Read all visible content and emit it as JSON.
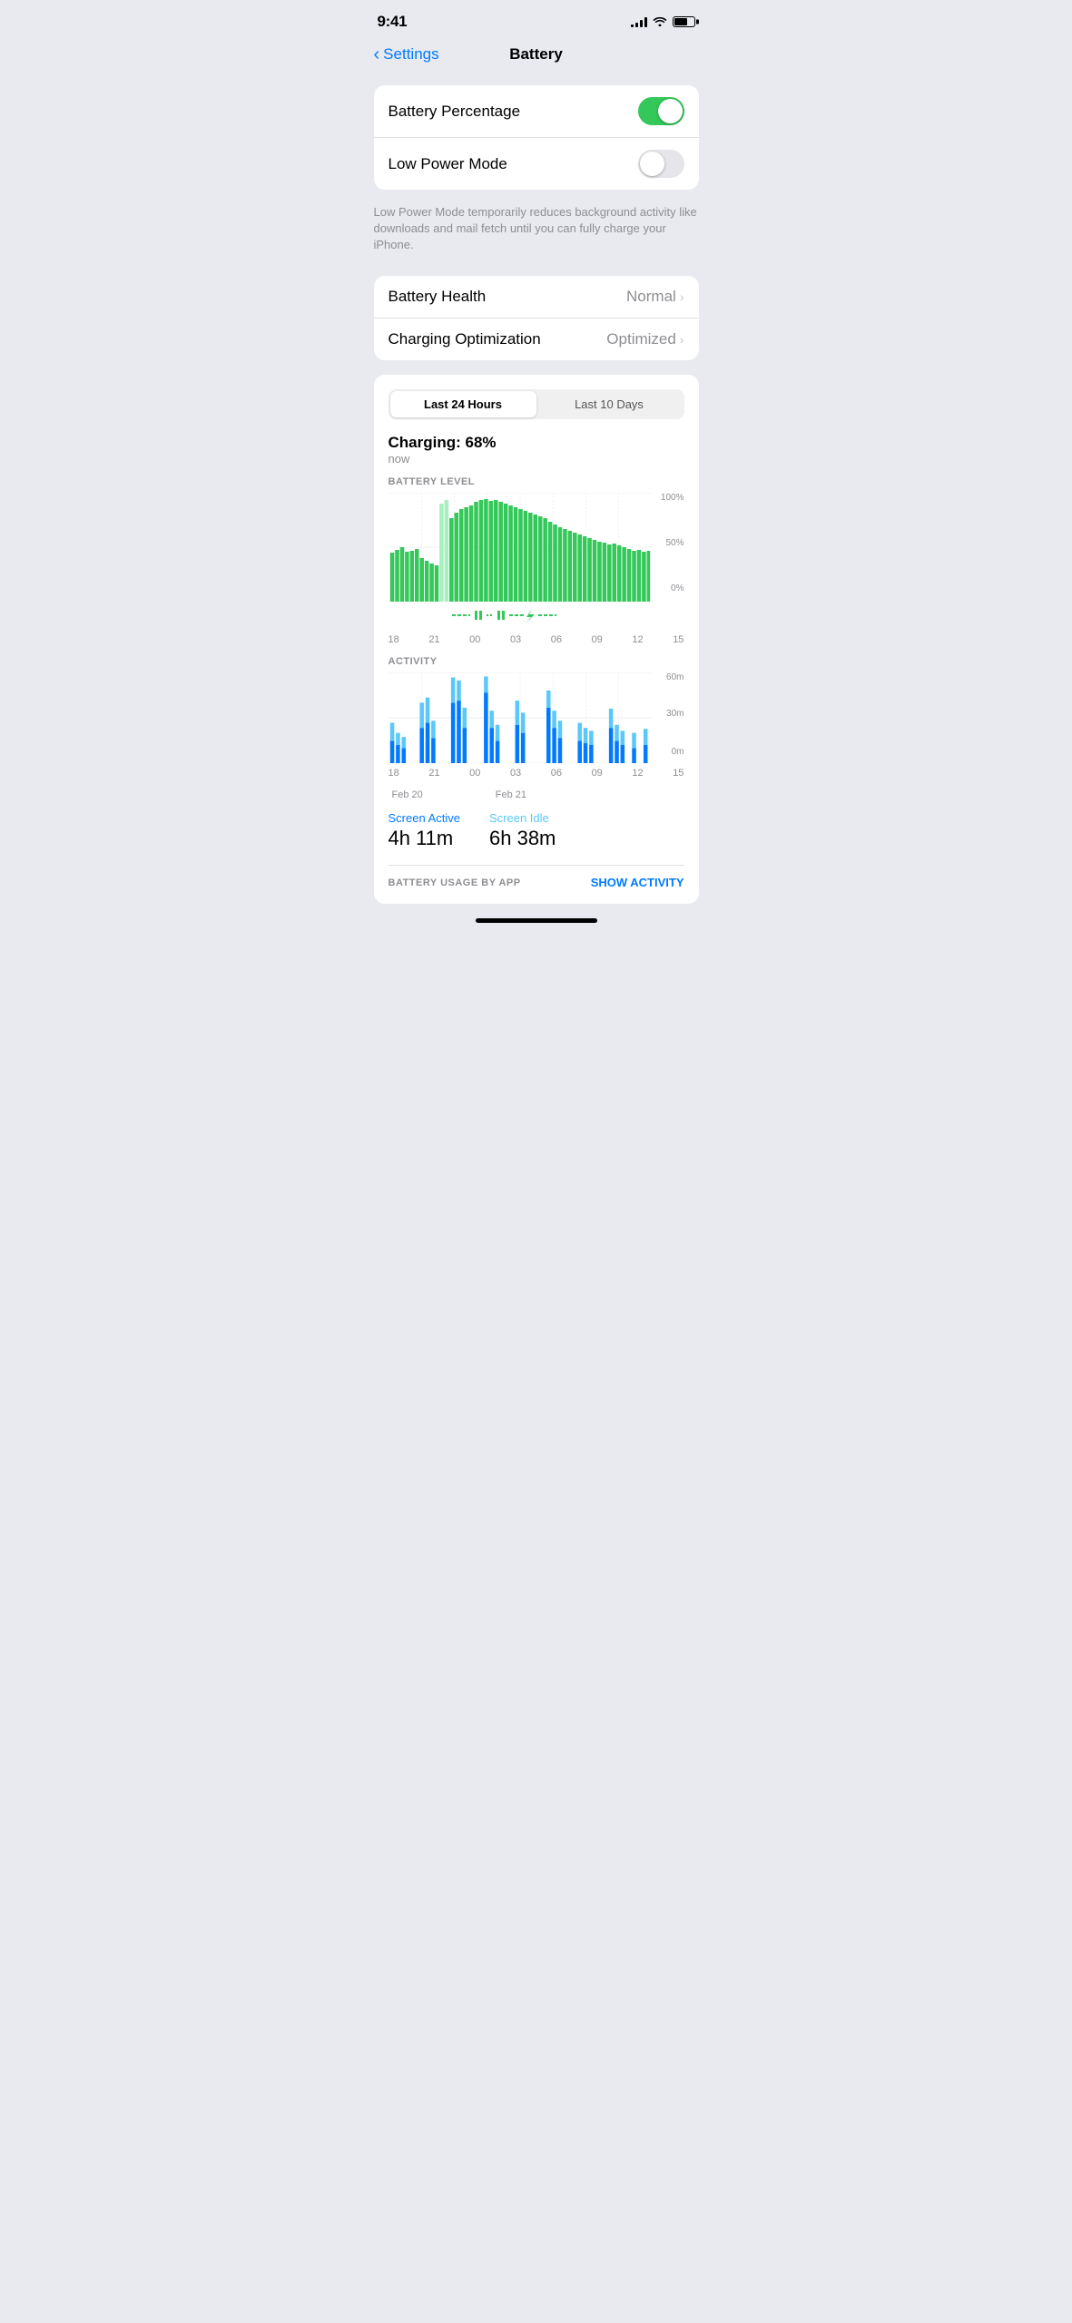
{
  "statusBar": {
    "time": "9:41",
    "batteryLevel": 70
  },
  "navigation": {
    "backLabel": "Settings",
    "pageTitle": "Battery"
  },
  "settings": {
    "batteryPercentage": {
      "label": "Battery Percentage",
      "enabled": true
    },
    "lowPowerMode": {
      "label": "Low Power Mode",
      "enabled": false,
      "description": "Low Power Mode temporarily reduces background activity like downloads and mail fetch until you can fully charge your iPhone."
    }
  },
  "health": {
    "batteryHealth": {
      "label": "Battery Health",
      "value": "Normal"
    },
    "chargingOptimization": {
      "label": "Charging Optimization",
      "value": "Optimized"
    }
  },
  "chart": {
    "segments": [
      {
        "label": "Last 24 Hours",
        "active": true
      },
      {
        "label": "Last 10 Days",
        "active": false
      }
    ],
    "chargingStatus": "Charging: 68%",
    "chargingTime": "now",
    "batteryLevelLabel": "BATTERY LEVEL",
    "activityLabel": "ACTIVITY",
    "timeLabels24h": [
      "18",
      "21",
      "00",
      "03",
      "06",
      "09",
      "12",
      "15"
    ],
    "yLabels": [
      "100%",
      "50%",
      "0%"
    ],
    "activityYLabels": [
      "60m",
      "30m",
      "0m"
    ],
    "dateLabels": [
      "Feb 20",
      "Feb 21"
    ],
    "screenActive": {
      "label": "Screen Active",
      "value": "4h 11m"
    },
    "screenIdle": {
      "label": "Screen Idle",
      "value": "6h 38m"
    }
  },
  "batteryUsage": {
    "label": "BATTERY USAGE BY APP",
    "showActivityBtn": "SHOW ACTIVITY"
  }
}
